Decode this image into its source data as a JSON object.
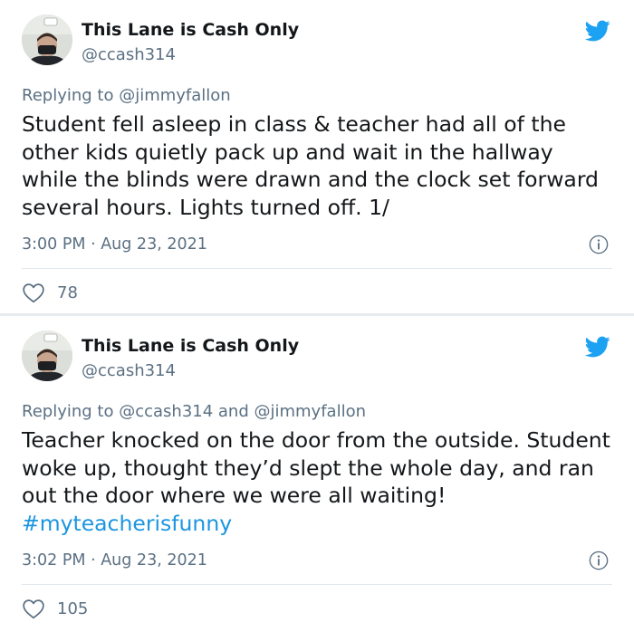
{
  "tweets": [
    {
      "author_name": "This Lane is Cash Only",
      "handle": "@ccash314",
      "reply_prefix": "Replying to ",
      "reply_mentions": "@jimmyfallon",
      "text": "Student fell asleep in class & teacher had all of the other kids quietly pack up and wait in the hallway while the blinds were drawn and the clock set forward several hours. Lights turned off. 1/",
      "hashtag": "",
      "timestamp": "3:00 PM · Aug 23, 2021",
      "likes": "78"
    },
    {
      "author_name": "This Lane is Cash Only",
      "handle": "@ccash314",
      "reply_prefix": "Replying to ",
      "reply_mentions": "@ccash314 and @jimmyfallon",
      "text": "Teacher knocked on the door from the outside. Student woke up, thought they’d slept the whole day, and ran out the door where we were all waiting! ",
      "hashtag": "#myteacherisfunny",
      "timestamp": "3:02 PM · Aug 23, 2021",
      "likes": "105"
    }
  ],
  "colors": {
    "brand_blue": "#1da1f2",
    "link_blue": "#1b95e0",
    "secondary_text": "#5b7083",
    "separator": "#e6ecf0"
  },
  "icons": [
    "twitter-bird-icon",
    "info-icon",
    "heart-icon"
  ]
}
